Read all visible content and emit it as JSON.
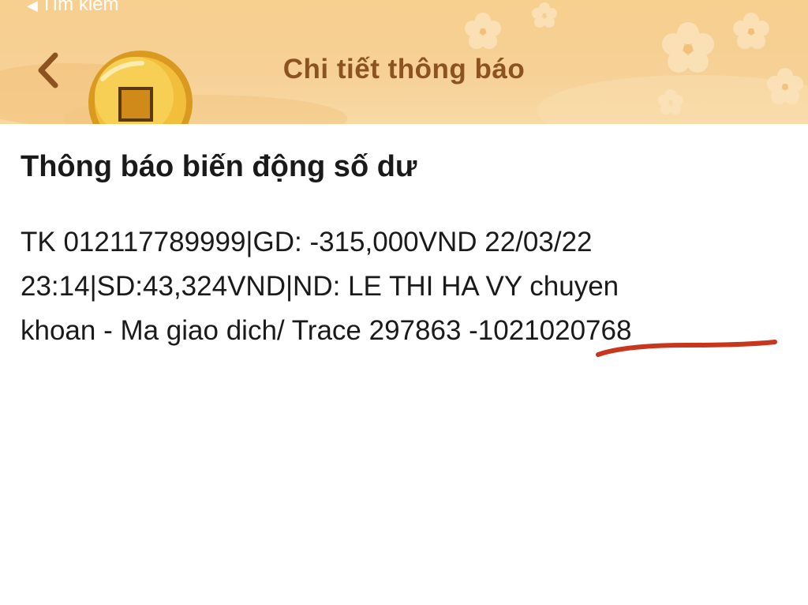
{
  "status_bar": {
    "back_app_label": "Tìm kiếm"
  },
  "header": {
    "title": "Chi tiết thông báo",
    "back_icon": "chevron-left-icon",
    "decorations": [
      "gold-coin-icon",
      "flower-pattern"
    ]
  },
  "notification": {
    "title": "Thông báo biến động số dư",
    "body_lines": [
      "TK 012117789999|GD: -315,000VND 22/03/22",
      "23:14|SD:43,324VND|ND: LE THI HA VY chuyen",
      "khoan - Ma giao dich/ Trace 297863 -1021020768"
    ]
  },
  "colors": {
    "header_bg": "#f7cf8e",
    "title_color": "#8c5321",
    "back_chevron": "#8c5321",
    "underline_mark": "#c8361e",
    "text": "#1a1a1a"
  }
}
